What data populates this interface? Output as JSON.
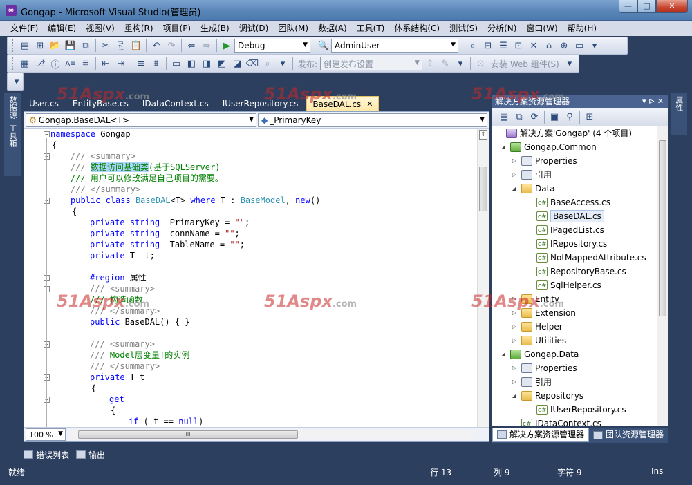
{
  "window": {
    "title": "Gongap - Microsoft Visual Studio(管理员)",
    "minimize": "—",
    "maximize": "□",
    "close": "✕"
  },
  "menu": [
    "文件(F)",
    "编辑(E)",
    "视图(V)",
    "重构(R)",
    "项目(P)",
    "生成(B)",
    "调试(D)",
    "团队(M)",
    "数据(A)",
    "工具(T)",
    "体系结构(C)",
    "测试(S)",
    "分析(N)",
    "窗口(W)",
    "帮助(H)"
  ],
  "toolbar": {
    "config": "Debug",
    "search_combo": "AdminUser",
    "publish_label": "发布:",
    "publish_combo": "创建发布设置",
    "web_components": "安装 Web 组件(S)"
  },
  "left_strip": {
    "server_explorer": "数据源",
    "toolbox": "工具箱"
  },
  "right_strip": {
    "properties": "属性"
  },
  "editor": {
    "tabs": [
      {
        "label": "User.cs",
        "active": false
      },
      {
        "label": "EntityBase.cs",
        "active": false
      },
      {
        "label": "IDataContext.cs",
        "active": false
      },
      {
        "label": "IUserRepository.cs",
        "active": false
      },
      {
        "label": "BaseDAL.cs",
        "active": true
      }
    ],
    "close_glyph": "✕",
    "type_combo": "Gongap.BaseDAL<T>",
    "member_combo": "_PrimaryKey",
    "zoom": "100 %",
    "hscroll_thumb": "III"
  },
  "code": {
    "l1": [
      "namespace",
      " Gongap"
    ],
    "l2": "{",
    "l3": "/// <summary>",
    "l4a": "/// ",
    "l4b": "数据访问基础类",
    "l4c": "(基于SQLServer)",
    "l5": "/// 用户可以修改满足自己项目的需要。",
    "l6": "/// </summary>",
    "l7": [
      "public",
      " ",
      "class",
      " ",
      "BaseDAL",
      "<T> ",
      "where",
      " T : ",
      "BaseModel",
      ", ",
      "new",
      "()"
    ],
    "l8": "{",
    "l9": [
      "private",
      " ",
      "string",
      " _PrimaryKey = ",
      "\"\"",
      ";"
    ],
    "l10": [
      "private",
      " ",
      "string",
      " _connName = ",
      "\"\"",
      ";"
    ],
    "l11": [
      "private",
      " ",
      "string",
      " _TableName = ",
      "\"\"",
      ";"
    ],
    "l12": [
      "private",
      " T _t;"
    ],
    "l13": [
      "#region",
      " 属性"
    ],
    "l14": "/// <summary>",
    "l15": "/// 构造函数",
    "l16": "/// </summary>",
    "l17": [
      "public",
      " BaseDAL() { }"
    ],
    "l18": "/// <summary>",
    "l19a": "/// ",
    "l19b": "Model层变量T的实例",
    "l20": "/// </summary>",
    "l21": [
      "private",
      " T t"
    ],
    "l22": "{",
    "l23": "get",
    "l24": "{",
    "l25": [
      "if",
      " (_t == ",
      "null",
      ")"
    ]
  },
  "solution_explorer": {
    "title": "解决方案资源管理器",
    "header_controls": "▾ ⊳ ✕",
    "items": [
      {
        "label": "解决方案'Gongap' (4 个项目)",
        "icon": "solution-icon"
      },
      {
        "label": "Gongap.Common",
        "icon": "project-icon"
      },
      {
        "label": "Properties",
        "icon": "properties-icon"
      },
      {
        "label": "引用",
        "icon": "references-icon"
      },
      {
        "label": "Data",
        "icon": "folder-icon"
      },
      {
        "label": "BaseAccess.cs",
        "icon": "cs-file-icon"
      },
      {
        "label": "BaseDAL.cs",
        "icon": "cs-file-icon"
      },
      {
        "label": "IPagedList.cs",
        "icon": "cs-file-icon"
      },
      {
        "label": "IRepository.cs",
        "icon": "cs-file-icon"
      },
      {
        "label": "NotMappedAttribute.cs",
        "icon": "cs-file-icon"
      },
      {
        "label": "RepositoryBase.cs",
        "icon": "cs-file-icon"
      },
      {
        "label": "SqlHelper.cs",
        "icon": "cs-file-icon"
      },
      {
        "label": "Entity",
        "icon": "folder-icon"
      },
      {
        "label": "Extension",
        "icon": "folder-icon"
      },
      {
        "label": "Helper",
        "icon": "folder-icon"
      },
      {
        "label": "Utilities",
        "icon": "folder-icon"
      },
      {
        "label": "Gongap.Data",
        "icon": "project-icon"
      },
      {
        "label": "Properties",
        "icon": "properties-icon"
      },
      {
        "label": "引用",
        "icon": "references-icon"
      },
      {
        "label": "Repositorys",
        "icon": "folder-icon"
      },
      {
        "label": "IUserRepository.cs",
        "icon": "cs-file-icon"
      },
      {
        "label": "IDataContext.cs",
        "icon": "cs-file-icon"
      }
    ],
    "tabs": [
      "解决方案资源管理器",
      "团队资源管理器"
    ]
  },
  "bottom_tools": [
    "错误列表",
    "输出"
  ],
  "status": {
    "ready": "就绪",
    "line": "行 13",
    "col": "列 9",
    "char": "字符 9",
    "mode": "Ins"
  },
  "watermark": {
    "brand": "51Aspx",
    "domain": ".com"
  }
}
